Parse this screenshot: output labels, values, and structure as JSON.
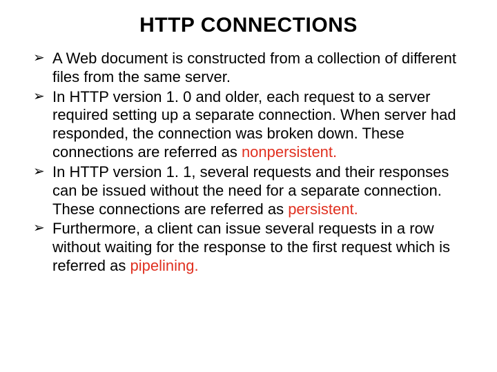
{
  "title": "HTTP CONNECTIONS",
  "bullets": {
    "b0": "A Web document is constructed from a collection of different files from the same server.",
    "b1a": "In HTTP version 1. 0 and older, each request to a server required setting up a separate connection. When server had responded, the connection was broken down. These connections are referred as ",
    "b1h": "nonpersistent.",
    "b2a": "In HTTP version 1. 1, several requests and their responses can be issued without the need for a separate connection. These connections are referred as ",
    "b2h": "persistent.",
    "b3a": "Furthermore, a client can issue several requests in a row without waiting for the response to the first request which is referred as ",
    "b3h": "pipelining."
  }
}
